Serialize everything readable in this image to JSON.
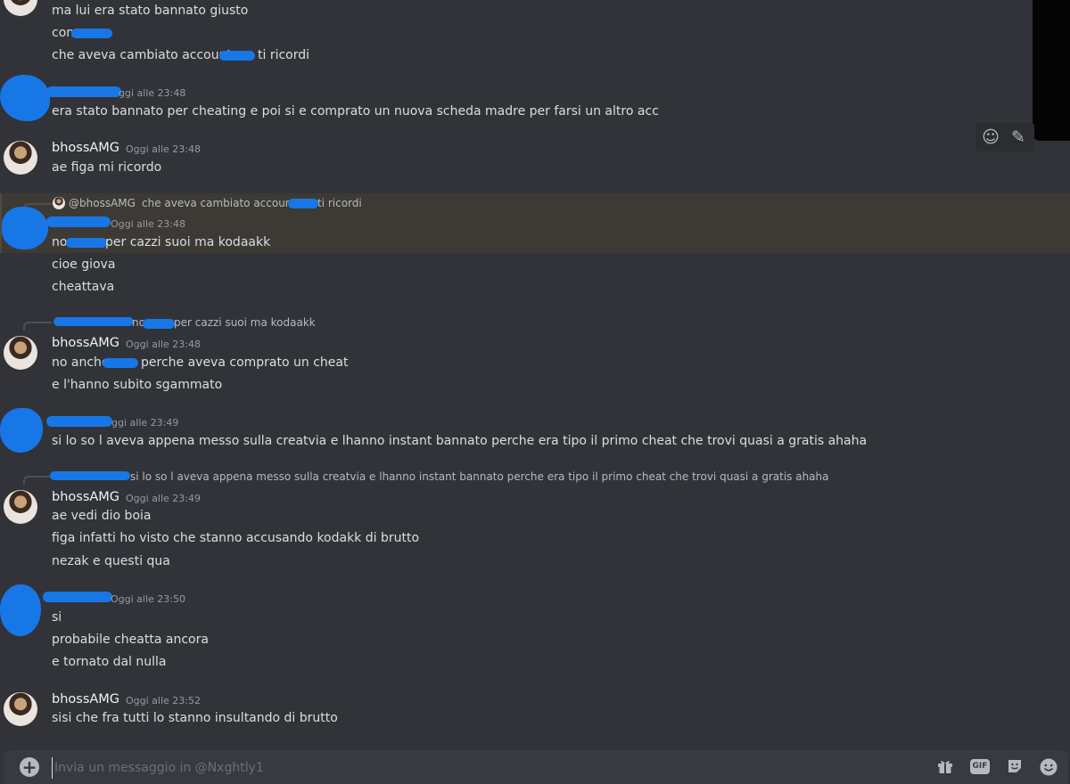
{
  "messages": {
    "m1": {
      "line1": "ma lui era stato bannato giusto",
      "line2": "con",
      "line3a": "che aveva cambiato account",
      "line3b": "ti ricordi"
    },
    "m2": {
      "time": "ggi alle 23:48",
      "line1": "era stato bannato per cheating e poi si e comprato un nuova scheda madre per farsi un altro acc"
    },
    "m3": {
      "username": "bhossAMG",
      "time": "Oggi alle 23:48",
      "line1": "ae figa mi ricordo"
    },
    "m4": {
      "reply_user": "@bhossAMG",
      "reply_text_a": "che aveva cambiato account",
      "reply_text_b": "ti ricordi",
      "time": "Oggi alle 23:48",
      "line1a": "no",
      "line1b": "per cazzi suoi ma kodaakk",
      "line2": "cioe giova",
      "line3": "cheattava"
    },
    "m5": {
      "reply_text_a": "no",
      "reply_text_b": "per cazzi suoi ma kodaakk",
      "username": "bhossAMG",
      "time": "Oggi alle 23:48",
      "line1a": "no anche",
      "line1b": "perche aveva comprato un cheat",
      "line2": "e l'hanno subito sgammato"
    },
    "m6": {
      "time": "ggi alle 23:49",
      "line1": "si lo so l aveva appena messo sulla creatvia e lhanno instant bannato perche era tipo il primo cheat che trovi quasi a gratis ahaha"
    },
    "m7": {
      "reply_text": "si lo so l aveva appena messo sulla creatvia e lhanno instant bannato perche era tipo il primo cheat che trovi quasi a gratis ahaha",
      "username": "bhossAMG",
      "time": "Oggi alle 23:49",
      "line1": "ae vedi dio boia",
      "line2": "figa infatti ho visto che stanno accusando kodakk di brutto",
      "line3": "nezak e questi qua"
    },
    "m8": {
      "time": "Oggi alle 23:50",
      "line1": "si",
      "line2": "probabile cheatta ancora",
      "line3": "e tornato dal nulla"
    },
    "m9": {
      "username": "bhossAMG",
      "time": "Oggi alle 23:52",
      "line1": "sisi che fra tutti lo stanno insultando di brutto"
    }
  },
  "composer": {
    "placeholder": "Invia un messaggio in @Nxghtly1",
    "gif_label": "GIF"
  },
  "icons": {
    "add": "plus-circle-icon",
    "gift": "gift-icon",
    "gif": "gif-icon",
    "sticker": "sticker-icon",
    "emoji": "emoji-icon",
    "reaction": "add-reaction-icon",
    "edit": "pencil-icon"
  },
  "colors": {
    "background": "#313338",
    "composer": "#383a40",
    "redaction": "#1877e6",
    "highlight": "#3d3a35"
  }
}
